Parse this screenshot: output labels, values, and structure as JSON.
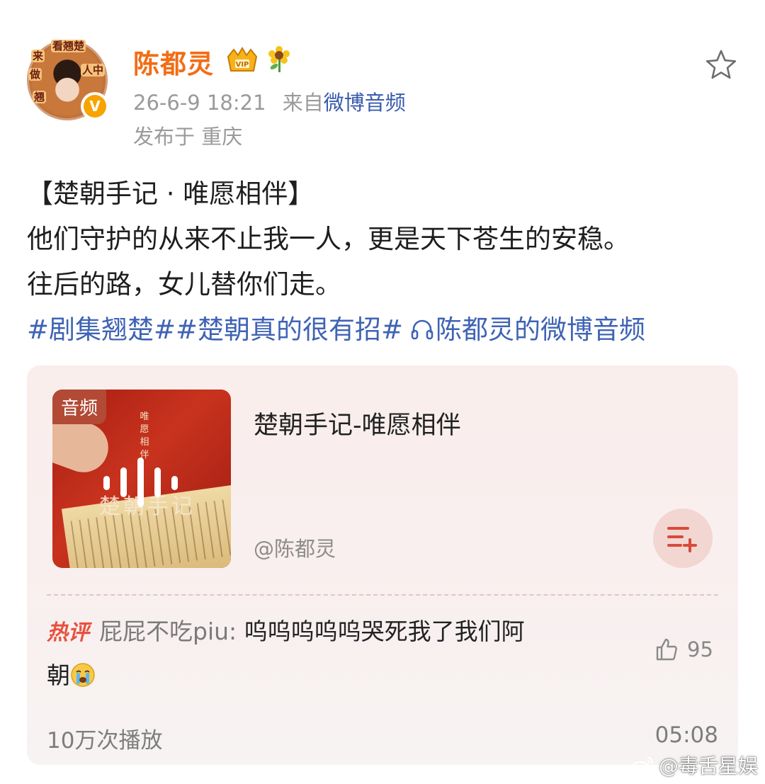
{
  "header": {
    "username": "陈都灵",
    "time": "26-6-9 18:21",
    "from_prefix": "来自",
    "source": "微博音频",
    "location": "发布于 重庆",
    "avatar_badge": "V"
  },
  "post": {
    "title_line": "【楚朝手记 · 唯愿相伴】",
    "line1": "他们守护的从来不止我一人，更是天下苍生的安稳。",
    "line2": "往后的路，女儿替你们走。",
    "hashtags": "#剧集翘楚##楚朝真的很有招#",
    "audio_link": "陈都灵的微博音频"
  },
  "audio_card": {
    "badge": "音频",
    "title": "楚朝手记-唯愿相伴",
    "author": "@陈都灵",
    "cover_vertical_text": "唯愿相伴",
    "cover_script_title": "楚朝手记",
    "hot_label": "热评",
    "commenter": "屁屁不吃piu:",
    "comment_line1": "呜呜呜呜呜哭死我了我们阿",
    "comment_line2": "朝",
    "likes": "95",
    "plays": "10万次播放",
    "duration": "05:08"
  },
  "avatar_text": {
    "a": "来",
    "b": "看翘楚",
    "c": "做",
    "d": "人中",
    "e": "翘"
  },
  "watermark": "@毒舌星娱",
  "colors": {
    "username": "#f26d15",
    "link": "#3f63b5",
    "hot": "#e8513f",
    "card_bg": "#f9eeec",
    "verified": "#f7a300"
  }
}
